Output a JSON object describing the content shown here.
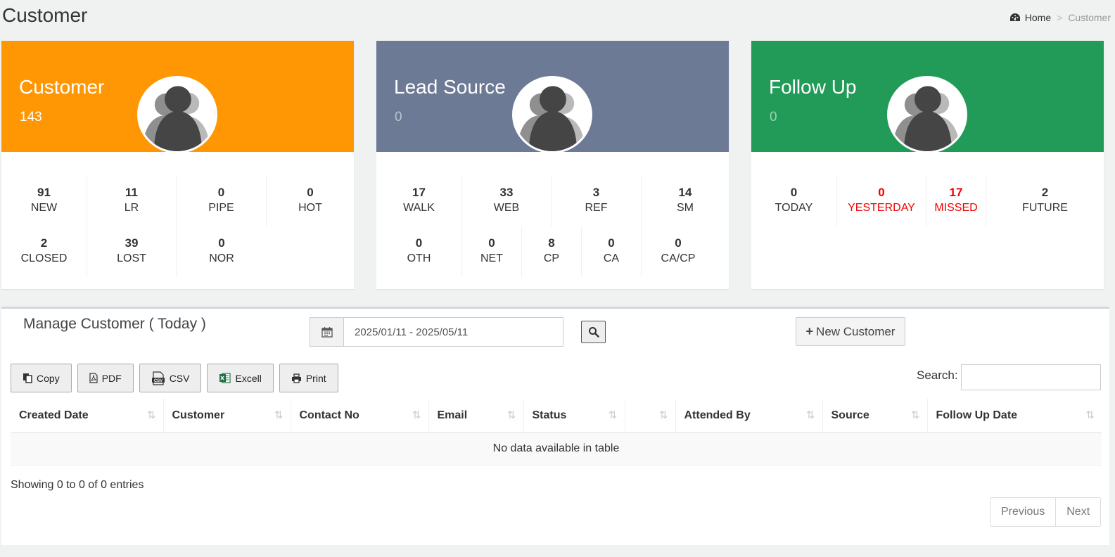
{
  "header": {
    "title": "Customer"
  },
  "breadcrumb": {
    "home": "Home",
    "separator": ">",
    "current": "Customer"
  },
  "cards": [
    {
      "title": "Customer",
      "count": "143",
      "color": "#ff9704",
      "rows": [
        [
          {
            "num": "91",
            "label": "NEW"
          },
          {
            "num": "11",
            "label": "LR"
          },
          {
            "num": "0",
            "label": "PIPE"
          },
          {
            "num": "0",
            "label": "HOT"
          }
        ],
        [
          {
            "num": "2",
            "label": "CLOSED"
          },
          {
            "num": "39",
            "label": "LOST"
          },
          {
            "num": "0",
            "label": "NOR"
          }
        ]
      ]
    },
    {
      "title": "Lead Source",
      "count": "0",
      "color": "#6c7a96",
      "rows": [
        [
          {
            "num": "17",
            "label": "WALK"
          },
          {
            "num": "33",
            "label": "WEB"
          },
          {
            "num": "3",
            "label": "REF"
          },
          {
            "num": "14",
            "label": "SM"
          }
        ],
        [
          {
            "num": "0",
            "label": "OTH"
          },
          {
            "num": "0",
            "label": "NET"
          },
          {
            "num": "8",
            "label": "CP"
          },
          {
            "num": "0",
            "label": "CA"
          },
          {
            "num": "0",
            "label": "CA/CP"
          }
        ]
      ]
    },
    {
      "title": "Follow Up",
      "count": "0",
      "color": "#229a58",
      "rows": [
        [
          {
            "num": "0",
            "label": "TODAY"
          },
          {
            "num": "0",
            "label": "YESTERDAY"
          },
          {
            "num": "17",
            "label": "MISSED"
          },
          {
            "num": "2",
            "label": "FUTURE"
          }
        ]
      ]
    }
  ],
  "manage": {
    "title": "Manage Customer ( Today )",
    "date_range": "2025/01/11 - 2025/05/11",
    "new_button": "New Customer",
    "tools": [
      "Copy",
      "PDF",
      "CSV",
      "Excell",
      "Print"
    ],
    "search_label": "Search:",
    "columns": [
      "Created Date",
      "Customer",
      "Contact No",
      "Email",
      "Status",
      "",
      "Attended By",
      "Source",
      "Follow Up Date"
    ],
    "empty_message": "No data available in table",
    "info": "Showing 0 to 0 of 0 entries",
    "prev": "Previous",
    "next": "Next"
  }
}
